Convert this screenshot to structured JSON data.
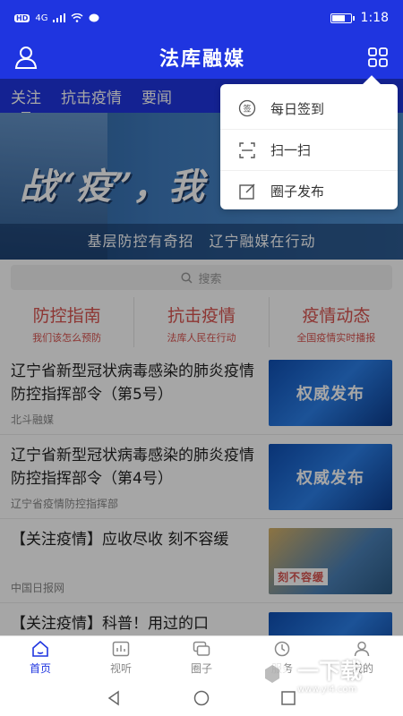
{
  "status_bar": {
    "hd": "HD",
    "signal": "4G",
    "time": "1:18",
    "battery_level": 0.75
  },
  "header": {
    "title": "法库融媒"
  },
  "tabs": [
    {
      "label": "关注"
    },
    {
      "label": "抗击疫情"
    },
    {
      "label": "要闻"
    }
  ],
  "banner": {
    "headline": "战“疫”，我",
    "subtitle": "基层防控有奇招　辽宁融媒在行动"
  },
  "search": {
    "placeholder": "搜索"
  },
  "quick_nav": [
    {
      "title": "防控指南",
      "subtitle": "我们该怎么预防"
    },
    {
      "title": "抗击疫情",
      "subtitle": "法库人民在行动"
    },
    {
      "title": "疫情动态",
      "subtitle": "全国疫情实时播报"
    }
  ],
  "news": [
    {
      "title": "辽宁省新型冠状病毒感染的肺炎疫情防控指挥部令（第5号）",
      "source": "北斗融媒",
      "thumb_text": "权威发布"
    },
    {
      "title": "辽宁省新型冠状病毒感染的肺炎疫情防控指挥部令（第4号）",
      "source": "辽宁省疫情防控指挥部",
      "thumb_text": "权威发布"
    },
    {
      "title": "【关注疫情】应收尽收 刻不容缓",
      "source": "中国日报网",
      "thumb_text": "刻不容缓"
    },
    {
      "title": "【关注疫情】科普！用过的口",
      "source": "",
      "thumb_text": ""
    }
  ],
  "dropdown": [
    {
      "label": "每日签到",
      "icon": "sign-in-icon"
    },
    {
      "label": "扫一扫",
      "icon": "scan-icon"
    },
    {
      "label": "圈子发布",
      "icon": "edit-icon"
    }
  ],
  "bottom_nav": [
    {
      "label": "首页",
      "icon": "home-icon"
    },
    {
      "label": "视听",
      "icon": "chart-icon"
    },
    {
      "label": "圈子",
      "icon": "chat-icon"
    },
    {
      "label": "服务",
      "icon": "clock-icon"
    },
    {
      "label": "我的",
      "icon": "user-icon"
    }
  ],
  "watermark": {
    "text": "一下载",
    "url": "www.yi4.com"
  },
  "colors": {
    "primary": "#1f35e0",
    "accent_red": "#d9534f"
  }
}
